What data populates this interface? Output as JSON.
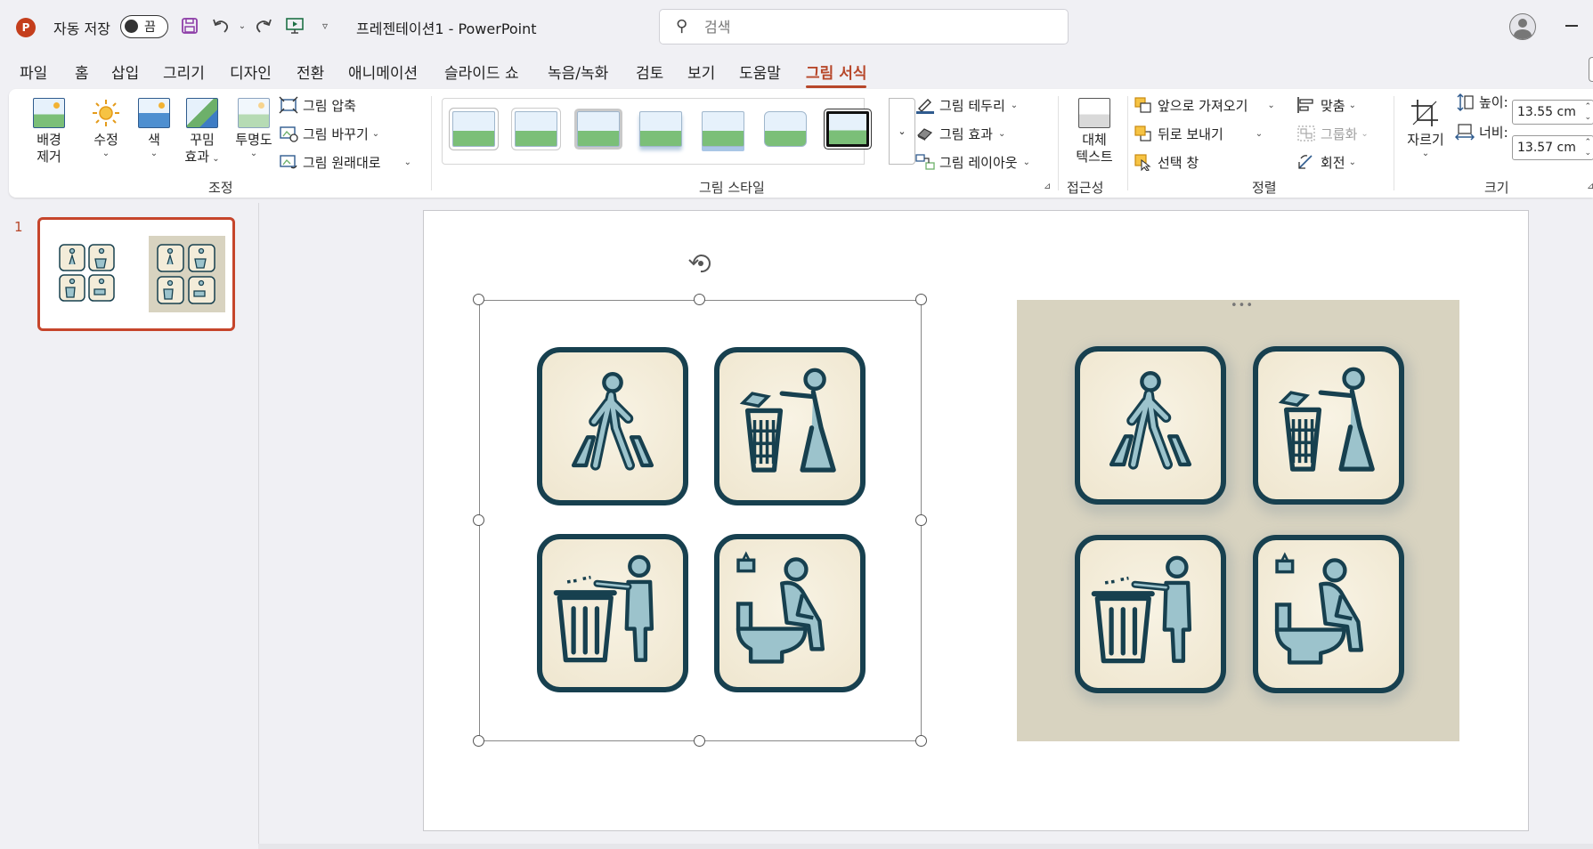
{
  "titlebar": {
    "app_logo": "P",
    "autosave_label": "자동 저장",
    "autosave_state": "끔",
    "doc_title": "프레젠테이션1  -  PowerPoint",
    "search_placeholder": "검색",
    "qat_icons": [
      "save-icon",
      "undo-icon",
      "redo-icon",
      "present-icon",
      "customize-icon"
    ]
  },
  "menu": {
    "tabs": [
      "파일",
      "홈",
      "삽입",
      "그리기",
      "디자인",
      "전환",
      "애니메이션",
      "슬라이드 쇼",
      "녹음/녹화",
      "검토",
      "보기",
      "도움말",
      "그림 서식"
    ],
    "active_tab": "그림 서식"
  },
  "ribbon": {
    "adjust": {
      "label": "조정",
      "remove_bg": [
        "배경",
        "제거"
      ],
      "corrections": "수정",
      "color": "색",
      "artistic": [
        "꾸밈",
        "효과"
      ],
      "transparency": "투명도",
      "compress": "그림 압축",
      "change": "그림 바꾸기",
      "reset": "그림 원래대로"
    },
    "styles": {
      "label": "그림 스타일",
      "border": "그림 테두리",
      "effects": "그림 효과",
      "layout": "그림 레이아웃"
    },
    "accessibility": {
      "label": "접근성",
      "alt_text": [
        "대체",
        "텍스트"
      ]
    },
    "arrange": {
      "label": "정렬",
      "bring_forward": "앞으로 가져오기",
      "send_backward": "뒤로 보내기",
      "selection_pane": "선택 창",
      "align": "맞춤",
      "group": "그룹화",
      "rotate": "회전"
    },
    "size": {
      "label": "크기",
      "crop": "자르기",
      "height_label": "높이:",
      "height_value": "13.55 cm",
      "width_label": "너비:",
      "width_value": "13.57 cm"
    }
  },
  "slides": {
    "current_number": "1"
  },
  "colors": {
    "accent": "#b7472a",
    "icon_stroke": "#17404f",
    "icon_fill": "#9cc3cc",
    "tile_bg": "#f3ecd9",
    "right_image_bg": "#d8d3c0"
  },
  "icons": [
    "walking-person-icon",
    "trash-throwing-icon",
    "trash-disposal-icon",
    "toilet-sitting-icon"
  ]
}
